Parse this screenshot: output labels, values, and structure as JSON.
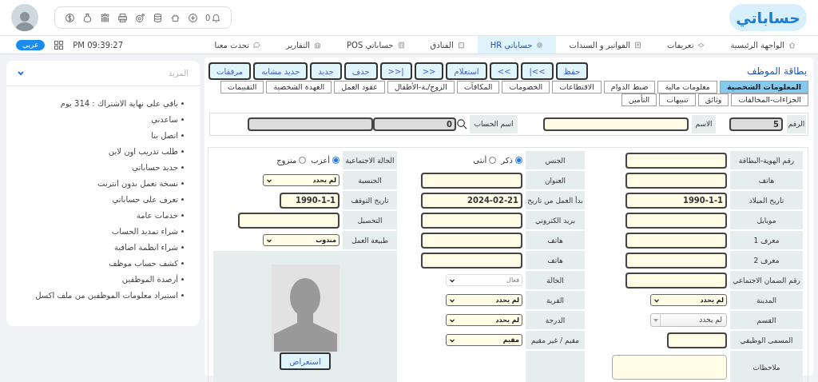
{
  "header": {
    "logo": "حساباتي",
    "notification_count": "0"
  },
  "nav": {
    "items": [
      {
        "label": "الواجهة الرئيسية",
        "selected": false
      },
      {
        "label": "تعريفات",
        "selected": false
      },
      {
        "label": "الفواتير و السندات",
        "selected": false
      },
      {
        "label": "حساباتي HR",
        "selected": true
      },
      {
        "label": "الفنادق",
        "selected": false
      },
      {
        "label": "حساباتي POS",
        "selected": false
      },
      {
        "label": "التقارير",
        "selected": false
      },
      {
        "label": "تحدث معنا",
        "selected": false
      }
    ],
    "time": "PM 09:39:27",
    "language": "عربي"
  },
  "sidebar": {
    "title": "المزيد",
    "items": [
      "باقي على نهاية الاشتراك : 314 يوم",
      "ساعدني",
      "اتصل بنا",
      "طلب تدريب اون لاين",
      "جديد حساباتي",
      "نسخة تعمل بدون انترنت",
      "تعرف على حساباتي",
      "خدمات عامة",
      "شراء تمديد الحساب",
      "شراء انظمة اضافية",
      "كشف حساب موظف",
      "أرصدة الموظفين",
      "استيراد معلومات الموظفين من ملف اكسل"
    ]
  },
  "panel": {
    "title": "بطاقة الموظف",
    "buttons": [
      "حفظ",
      "|<<",
      "<<",
      "استعلام",
      ">>",
      ">>|",
      "حذف",
      "جديد",
      "جديد مشابه",
      "مرفقات"
    ],
    "tab_rows": [
      [
        {
          "label": "المعلومات الشخصية",
          "selected": true
        },
        {
          "label": "معلومات مالية",
          "selected": false
        },
        {
          "label": "ضبط الدوام",
          "selected": false
        },
        {
          "label": "الاقتطاعات",
          "selected": false
        },
        {
          "label": "الخصومات",
          "selected": false
        },
        {
          "label": "المكافآت",
          "selected": false
        },
        {
          "label": "الزوج/ـة-الأطفال",
          "selected": false
        },
        {
          "label": "عقود العمل",
          "selected": false
        },
        {
          "label": "العهدة الشخصية",
          "selected": false
        },
        {
          "label": "التقييمات",
          "selected": false
        }
      ],
      [
        {
          "label": "الجزاءات-المخالفات",
          "selected": false
        },
        {
          "label": "وثائق",
          "selected": false
        },
        {
          "label": "تنبيهات",
          "selected": false
        },
        {
          "label": "التأمين",
          "selected": false
        }
      ]
    ]
  },
  "record": {
    "number_label": "الرقم",
    "number": "5",
    "name_label": "الاسم",
    "account_label": "اسم الحساب",
    "account_code": "0"
  },
  "details": {
    "photo_button": "استعراض",
    "rows": [
      {
        "cells": [
          {
            "label": "رقم الهوية-البطاقة",
            "field": {
              "kind": "text"
            }
          },
          {
            "label": "الجنس",
            "field": {
              "kind": "radio",
              "options": [
                {
                  "label": "ذكر",
                  "selected": true
                },
                {
                  "label": "أنثى",
                  "selected": false
                }
              ]
            }
          },
          {
            "label": "الحالة الاجتماعية",
            "field": {
              "kind": "radio",
              "options": [
                {
                  "label": "أعزب",
                  "selected": true
                },
                {
                  "label": "متزوج",
                  "selected": false
                }
              ]
            }
          }
        ]
      },
      {
        "cells": [
          {
            "label": "هاتف",
            "field": {
              "kind": "text"
            }
          },
          {
            "label": "العنوان",
            "field": {
              "kind": "text"
            }
          },
          {
            "label": "الجنسية",
            "field": {
              "kind": "select",
              "value": "لم يحدد",
              "disabled": false
            }
          }
        ]
      },
      {
        "cells": [
          {
            "label": "تاريخ الميلاد",
            "field": {
              "kind": "text",
              "value": "1990-1-1"
            }
          },
          {
            "label": "بدأ العمل من تاريخ",
            "field": {
              "kind": "text",
              "value": "2024-02-21"
            }
          },
          {
            "label": "تاريخ التوقف",
            "field": {
              "kind": "short",
              "value": "1990-1-1"
            }
          }
        ]
      },
      {
        "cells": [
          {
            "label": "موبايل",
            "field": {
              "kind": "text"
            }
          },
          {
            "label": "بريد الكتروني",
            "field": {
              "kind": "text"
            }
          },
          {
            "label": "التحصيل",
            "field": {
              "kind": "text"
            }
          }
        ]
      },
      {
        "cells": [
          {
            "label": "معرف 1",
            "field": {
              "kind": "text"
            }
          },
          {
            "label": "هاتف",
            "field": {
              "kind": "text"
            }
          },
          {
            "label": "طبيعة العمل",
            "field": {
              "kind": "select",
              "value": "مندوب",
              "disabled": false
            }
          }
        ]
      },
      {
        "cells": [
          {
            "label": "معرف 2",
            "field": {
              "kind": "text"
            }
          },
          {
            "label": "هاتف",
            "field": {
              "kind": "text"
            }
          }
        ]
      },
      {
        "cells": [
          {
            "label": "رقم الضمان الاجتماعي",
            "field": {
              "kind": "text"
            }
          },
          {
            "label": "الحالة",
            "field": {
              "kind": "select",
              "value": "فعال",
              "disabled": true
            }
          }
        ]
      },
      {
        "cells": [
          {
            "label": "المدينة",
            "field": {
              "kind": "select",
              "value": "لم يحدد",
              "disabled": false
            }
          },
          {
            "label": "القرية",
            "field": {
              "kind": "select",
              "value": "لم يحدد",
              "disabled": false
            }
          }
        ]
      },
      {
        "cells": [
          {
            "label": "القسم",
            "field": {
              "kind": "combo",
              "value": "لم يحدد"
            }
          },
          {
            "label": "الدرجة",
            "field": {
              "kind": "select",
              "value": "لم يحدد",
              "disabled": false
            }
          }
        ]
      },
      {
        "cells": [
          {
            "label": "المسمى الوظيفي",
            "field": {
              "kind": "short"
            }
          },
          {
            "label": "مقيم / غير مقيم",
            "field": {
              "kind": "select",
              "value": "مقيم",
              "disabled": false
            }
          }
        ]
      },
      {
        "cells": [
          {
            "label": "ملاحظات",
            "field": {
              "kind": "textarea"
            }
          },
          {
            "field": {
              "kind": "blank"
            }
          }
        ]
      }
    ]
  }
}
